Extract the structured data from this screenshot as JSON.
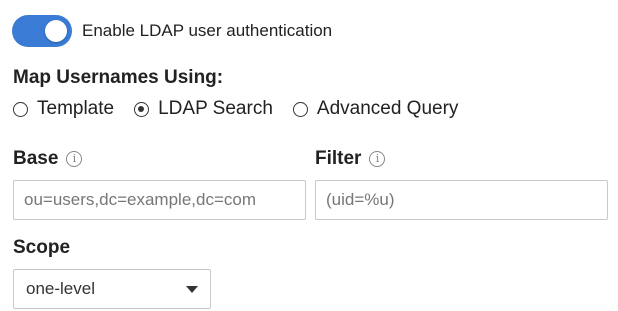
{
  "ldap_toggle": {
    "label": "Enable LDAP user authentication",
    "enabled": true,
    "color": "#3a7bd5"
  },
  "map_usernames": {
    "title": "Map Usernames Using:",
    "options": [
      {
        "label": "Template",
        "selected": false
      },
      {
        "label": "LDAP Search",
        "selected": true
      },
      {
        "label": "Advanced Query",
        "selected": false
      }
    ]
  },
  "base": {
    "label": "Base",
    "info_icon": "info-icon",
    "placeholder": "ou=users,dc=example,dc=com",
    "value": ""
  },
  "filter": {
    "label": "Filter",
    "info_icon": "info-icon",
    "placeholder": "(uid=%u)",
    "value": ""
  },
  "scope": {
    "label": "Scope",
    "selected": "one-level",
    "icon": "chevron-down-icon"
  }
}
